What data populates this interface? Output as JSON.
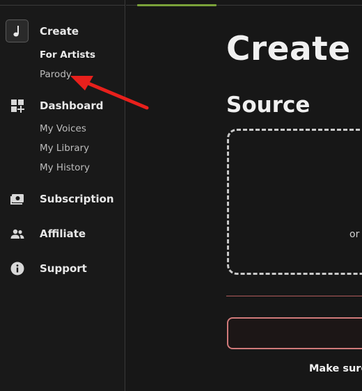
{
  "sidebar": {
    "create": {
      "label": "Create",
      "icon": "music-note-icon"
    },
    "create_items": [
      "For Artists",
      "Parody"
    ],
    "dashboard": {
      "label": "Dashboard",
      "icon": "dashboard-add-icon"
    },
    "dashboard_items": [
      "My Voices",
      "My Library",
      "My History"
    ],
    "subscription": {
      "label": "Subscription",
      "icon": "subscription-icon"
    },
    "affiliate": {
      "label": "Affiliate",
      "icon": "people-icon"
    },
    "support": {
      "label": "Support",
      "icon": "info-icon"
    }
  },
  "main": {
    "title": "Create A",
    "source_heading": "Source",
    "dropzone_text": "or",
    "footnote": "Make sure",
    "text_field_value": ""
  },
  "colors": {
    "progress": "#7ba23a",
    "annotation_arrow": "#e8201c",
    "field_border": "#d07a7a"
  }
}
